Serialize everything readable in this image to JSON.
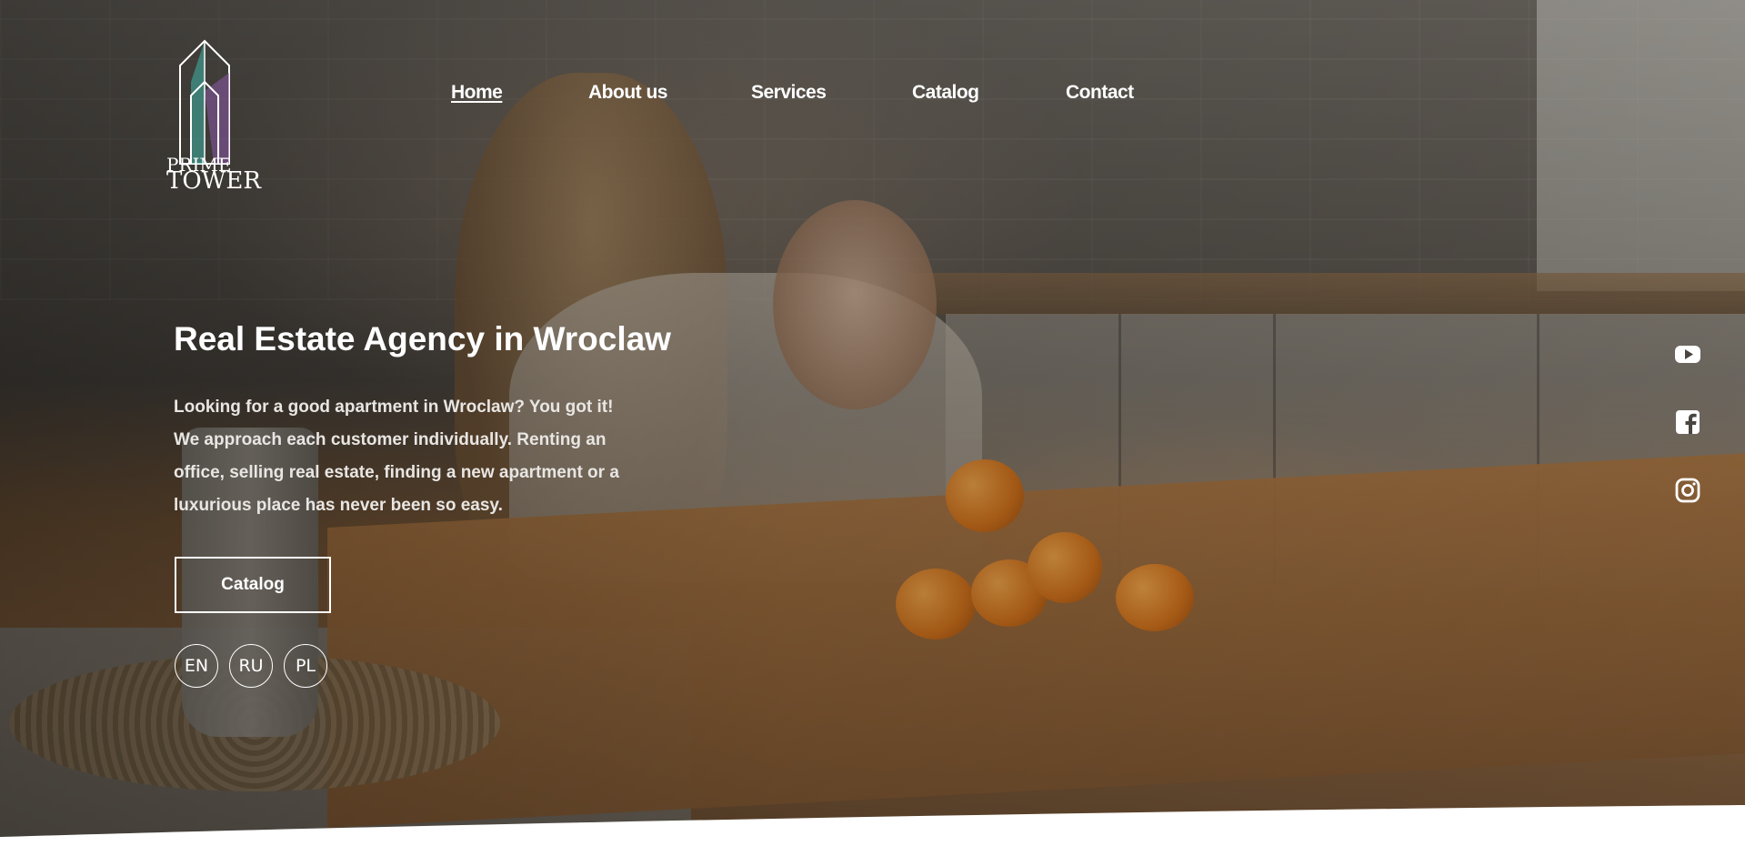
{
  "brand": {
    "logo_line1": "PRIME",
    "logo_line2": "TOWER"
  },
  "nav": {
    "items": [
      {
        "label": "Home",
        "active": true
      },
      {
        "label": "About us",
        "active": false
      },
      {
        "label": "Services",
        "active": false
      },
      {
        "label": "Catalog",
        "active": false
      },
      {
        "label": "Contact",
        "active": false
      }
    ]
  },
  "hero": {
    "title": "Real Estate Agency in Wroclaw",
    "description_lines": [
      "Looking for a good apartment in Wroclaw? You got it!",
      "We approach each customer individually. Renting an",
      "office, selling real estate, finding a new apartment or a",
      "luxurious place has never been so easy."
    ],
    "cta_label": "Catalog"
  },
  "languages": [
    "EN",
    "RU",
    "PL"
  ],
  "social": [
    {
      "icon": "youtube-icon"
    },
    {
      "icon": "facebook-icon"
    },
    {
      "icon": "instagram-icon"
    }
  ],
  "colors": {
    "text": "#ffffff",
    "logo_teal": "#3fb5a8",
    "logo_purple": "#8a5aa8"
  }
}
